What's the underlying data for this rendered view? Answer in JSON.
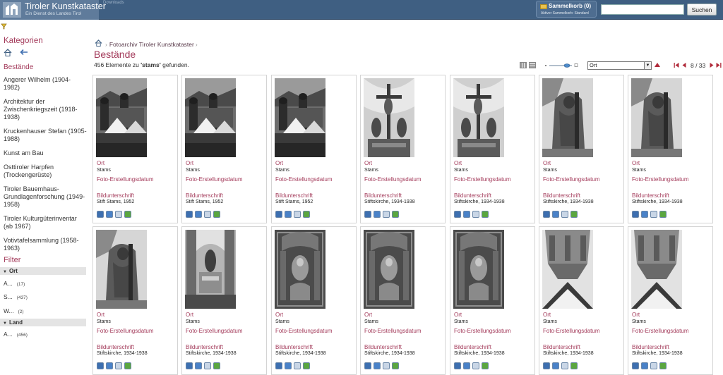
{
  "header": {
    "logo_title": "Tiroler Kunstkataster",
    "logo_subtitle": "Ein Dienst des Landes Tirol",
    "downloads_label": "Downloads",
    "basket_label": "Sammelkorb (0)",
    "basket_active": "Aktiver Sammelkorb: Standard",
    "search_value": "",
    "search_button": "Suchen"
  },
  "sidebar": {
    "heading": "Kategorien",
    "section": "Bestände",
    "categories": [
      "Angerer Wilhelm (1904-1982)",
      "Architektur der Zwischenkriegszeit (1918-1938)",
      "Kruckenhauser Stefan (1905-1988)",
      "Kunst am Bau",
      "Osttiroler Harpfen (Trockengerüste)",
      "Tiroler Bauemhaus-Grundlagenforschung (1949-1958)",
      "Tiroler Kulturgüterinventar (ab 1967)",
      "Votivtafelsammlung (1958-1963)"
    ],
    "filter_heading": "Filter",
    "facets": [
      {
        "name": "Ort",
        "items": [
          {
            "label": "A...",
            "count": "(17)"
          },
          {
            "label": "S...",
            "count": "(437)"
          },
          {
            "label": "W...",
            "count": "(2)"
          }
        ]
      },
      {
        "name": "Land",
        "items": [
          {
            "label": "A...",
            "count": "(456)"
          }
        ]
      }
    ]
  },
  "main": {
    "breadcrumb": "Fotoarchiv Tiroler Kunstkataster",
    "title": "Bestände",
    "count_prefix": "456 Elemente zu ",
    "query": "'stams'",
    "count_suffix": " gefunden.",
    "sort_value": "Ort",
    "page_info": "8 / 33"
  },
  "labels": {
    "ort": "Ort",
    "date": "Foto-Erstellungsdatum",
    "caption": "Bildunterschrift"
  },
  "colors": {
    "accent": "#a33a5a",
    "header": "#3f5f82"
  },
  "cards": [
    {
      "ort": "Stams",
      "caption": "Stift Stams, 1952",
      "image": "abbey-exterior"
    },
    {
      "ort": "Stams",
      "caption": "Stift Stams, 1952",
      "image": "abbey-exterior"
    },
    {
      "ort": "Stams",
      "caption": "Stift Stams, 1952",
      "image": "abbey-exterior"
    },
    {
      "ort": "Stams",
      "caption": "Stiftskirche, 1934-1938",
      "image": "crucifix-altar"
    },
    {
      "ort": "Stams",
      "caption": "Stiftskirche, 1934-1938",
      "image": "crucifix-altar"
    },
    {
      "ort": "Stams",
      "caption": "Stiftskirche, 1934-1938",
      "image": "baroque-statue"
    },
    {
      "ort": "Stams",
      "caption": "Stiftskirche, 1934-1938",
      "image": "baroque-statue"
    },
    {
      "ort": "Stams",
      "caption": "Stiftskirche, 1934-1938",
      "image": "baroque-statue"
    },
    {
      "ort": "Stams",
      "caption": "Stiftskirche, 1934-1938",
      "image": "church-interior"
    },
    {
      "ort": "Stams",
      "caption": "Stiftskirche, 1934-1938",
      "image": "carved-panel"
    },
    {
      "ort": "Stams",
      "caption": "Stiftskirche, 1934-1938",
      "image": "carved-panel"
    },
    {
      "ort": "Stams",
      "caption": "Stiftskirche, 1934-1938",
      "image": "carved-panel"
    },
    {
      "ort": "Stams",
      "caption": "Stiftskirche, 1934-1938",
      "image": "pulpit"
    },
    {
      "ort": "Stams",
      "caption": "Stiftskirche, 1934-1938",
      "image": "pulpit"
    }
  ]
}
